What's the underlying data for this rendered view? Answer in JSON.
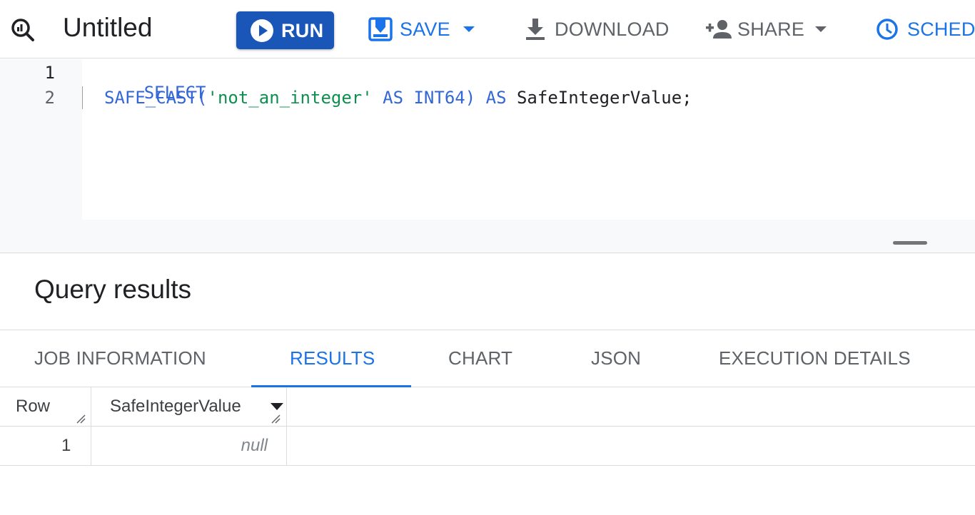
{
  "toolbar": {
    "title": "Untitled",
    "run_label": "RUN",
    "save_label": "SAVE",
    "download_label": "DOWNLOAD",
    "share_label": "SHARE",
    "schedule_label": "SCHEDU",
    "icons": [
      "query-icon",
      "play-icon",
      "save-icon",
      "chevron-down-icon",
      "download-icon",
      "person-add-icon",
      "clock-icon"
    ]
  },
  "editor": {
    "line_numbers": [
      "1",
      "2"
    ],
    "line1": {
      "keyword": "SELECT"
    },
    "line2": {
      "func": "SAFE_CAST(",
      "string": "'not_an_integer'",
      "kw_as1": " AS ",
      "type": "INT64)",
      "kw_as2": " AS ",
      "alias": "SafeIntegerValue;"
    }
  },
  "results": {
    "title": "Query results",
    "tabs": [
      {
        "label": "JOB INFORMATION",
        "active": false
      },
      {
        "label": "RESULTS",
        "active": true
      },
      {
        "label": "CHART",
        "active": false
      },
      {
        "label": "JSON",
        "active": false
      },
      {
        "label": "EXECUTION DETAILS",
        "active": false
      }
    ],
    "columns": [
      "Row",
      "SafeIntegerValue"
    ],
    "rows": [
      {
        "row": "1",
        "value": "null"
      }
    ]
  },
  "colors": {
    "accent": "#1a73e8",
    "run_button": "#1a56b8",
    "string": "#0d904f",
    "keyword": "#3367d6"
  }
}
